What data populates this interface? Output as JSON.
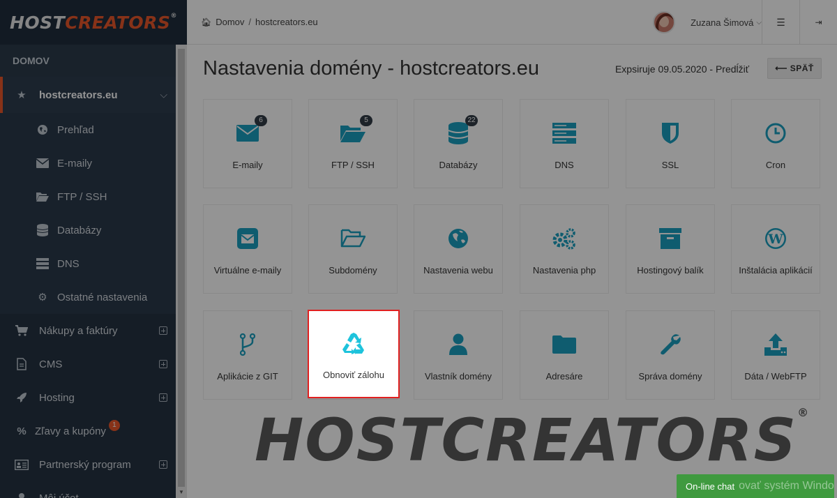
{
  "logo": {
    "host": "HOST",
    "creators": "CREATORS",
    "reg": "®"
  },
  "sidebar": {
    "heading": "DOMOV",
    "active": {
      "label": "hostcreators.eu",
      "icon": "star-icon"
    },
    "sub_items": [
      {
        "label": "Prehľad",
        "icon": "globe-icon"
      },
      {
        "label": "E-maily",
        "icon": "envelope-icon"
      },
      {
        "label": "FTP / SSH",
        "icon": "folder-open-icon"
      },
      {
        "label": "Databázy",
        "icon": "database-icon"
      },
      {
        "label": "DNS",
        "icon": "server-icon"
      },
      {
        "label": "Ostatné nastavenia",
        "icon": "gear-icon"
      }
    ],
    "items": [
      {
        "label": "Nákupy a faktúry",
        "icon": "cart-icon"
      },
      {
        "label": "CMS",
        "icon": "file-icon"
      },
      {
        "label": "Hosting",
        "icon": "rocket-icon"
      },
      {
        "label": "Zľavy a kupóny",
        "icon": "percent-icon",
        "badge": "1"
      },
      {
        "label": "Partnerský program",
        "icon": "id-card-icon"
      },
      {
        "label": "Môj účet",
        "icon": "user-icon"
      }
    ]
  },
  "topbar": {
    "breadcrumb": {
      "home": "Domov",
      "sep": "/",
      "current": "hostcreators.eu"
    },
    "user": {
      "name": "Zuzana Šimová",
      "caret": "⌵"
    }
  },
  "main": {
    "title": "Nastavenia domény - hostcreators.eu",
    "expiry": "Expsiruje 09.05.2020 - Predĺžiť",
    "back_label": "⟵  SPÄŤ"
  },
  "tiles": [
    {
      "label": "E-maily",
      "icon": "envelope-icon",
      "count": "6"
    },
    {
      "label": "FTP / SSH",
      "icon": "folder-open-icon",
      "count": "5"
    },
    {
      "label": "Databázy",
      "icon": "database-icon",
      "count": "22"
    },
    {
      "label": "DNS",
      "icon": "server-icon"
    },
    {
      "label": "SSL",
      "icon": "shield-icon"
    },
    {
      "label": "Cron",
      "icon": "clock-icon"
    },
    {
      "label": "Virtuálne e-maily",
      "icon": "envelope-square-icon"
    },
    {
      "label": "Subdomény",
      "icon": "folder-outline-icon"
    },
    {
      "label": "Nastavenia webu",
      "icon": "globe-icon"
    },
    {
      "label": "Nastavenia php",
      "icon": "gears-icon"
    },
    {
      "label": "Hostingový balík",
      "icon": "archive-icon"
    },
    {
      "label": "Inštalácia aplikácií",
      "icon": "wordpress-icon"
    },
    {
      "label": "Aplikácie z GIT",
      "icon": "code-fork-icon"
    },
    {
      "label": "Obnoviť zálohu",
      "icon": "recycle-icon"
    },
    {
      "label": "Vlastník domény",
      "icon": "user-icon"
    },
    {
      "label": "Adresáre",
      "icon": "folder-icon"
    },
    {
      "label": "Správa domény",
      "icon": "wrench-icon"
    },
    {
      "label": "Dáta / WebFTP",
      "icon": "upload-icon"
    }
  ],
  "watermark": "HOSTCREATORS",
  "watermark_reg": "®",
  "chat": {
    "label": "On-line chat",
    "ghost": "ovať systém Windo"
  },
  "colors": {
    "accent": "#e8572a",
    "icon": "#1a9fbf",
    "sidebar": "#1f2d3d",
    "highlight": "#e02020",
    "chat": "#3f9a3f"
  }
}
